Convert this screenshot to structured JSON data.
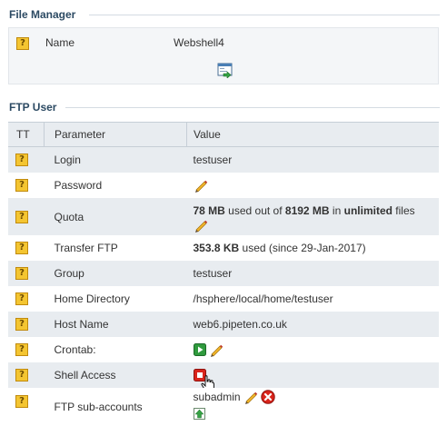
{
  "file_manager": {
    "title": "File Manager",
    "row": {
      "label": "Name",
      "value": "Webshell4"
    }
  },
  "ftp_user": {
    "title": "FTP User",
    "columns": [
      "TT",
      "Parameter",
      "Value"
    ],
    "login": {
      "label": "Login",
      "value": "testuser"
    },
    "password": {
      "label": "Password"
    },
    "quota": {
      "label": "Quota",
      "used": "78 MB",
      "t1": " used out of ",
      "total": "8192 MB",
      "t2": " in ",
      "files": "unlimited",
      "t3": " files"
    },
    "transfer": {
      "label": "Transfer FTP",
      "amount": "353.8 KB",
      "rest": " used (since 29-Jan-2017)"
    },
    "group": {
      "label": "Group",
      "value": "testuser"
    },
    "home": {
      "label": "Home Directory",
      "value": "/hsphere/local/home/testuser"
    },
    "host": {
      "label": "Host Name",
      "value": "web6.pipeten.co.uk"
    },
    "crontab": {
      "label": "Crontab:"
    },
    "shell": {
      "label": "Shell Access"
    },
    "subaccounts": {
      "label": "FTP sub-accounts",
      "value": "subadmin"
    }
  },
  "colors": {
    "section_title": "#2c4a63",
    "header_bg": "#e8ecf0",
    "help_icon": "#f4c531",
    "shell_off": "#d9241b",
    "crontab_on": "#2f9a3d"
  },
  "icons": [
    "help-icon",
    "open-file-manager-icon",
    "pencil-icon",
    "play-icon",
    "stop-icon",
    "delete-icon",
    "add-icon",
    "hand-cursor-icon"
  ]
}
